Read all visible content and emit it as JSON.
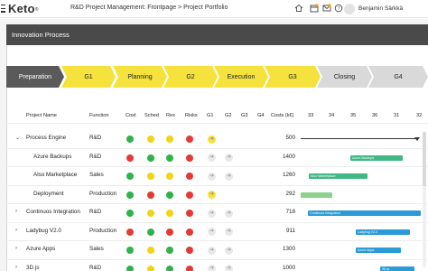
{
  "app": {
    "brand": "Keto",
    "brand_mark": "®",
    "breadcrumb": "R&D Project Management: Frontpage > Project Portfolio",
    "user_name": "Benjamin Särkkä",
    "icons": [
      "home-icon",
      "calendar-icon",
      "message-icon",
      "help-icon"
    ]
  },
  "panel": {
    "title": "Innovation Process"
  },
  "process": [
    {
      "label": "Preparation",
      "state": "active"
    },
    {
      "label": "G1",
      "state": "yellow"
    },
    {
      "label": "Planning",
      "state": "yellow"
    },
    {
      "label": "G2",
      "state": "yellow"
    },
    {
      "label": "Execution",
      "state": "yellow"
    },
    {
      "label": "G3",
      "state": "yellow"
    },
    {
      "label": "Closing",
      "state": "grey"
    },
    {
      "label": "G4",
      "state": "grey"
    }
  ],
  "colors": {
    "active": "#5a5a5a",
    "yellow": "#f5e23c",
    "grey": "#d9d9d9",
    "green": "#2db34a",
    "yellow_dot": "#f0d516",
    "red": "#e53935",
    "gantt_blue": "#2a9bd6",
    "gantt_green": "#41b883",
    "gantt_lightgreen": "#8ed08e"
  },
  "table": {
    "headers": {
      "project_name": "Project Name",
      "function": "Function",
      "cost": "Cost",
      "sched": "Sched",
      "res": "Res",
      "risks": "Risks",
      "g1": "G1",
      "g2": "G2",
      "g3": "G3",
      "g4": "G4",
      "costs": "Costs (k€)"
    },
    "weeks": [
      "33",
      "34",
      "35",
      "36",
      "31",
      "32"
    ],
    "rows": [
      {
        "toggle": "⌄",
        "name": "Process Engine",
        "function": "R&D",
        "cost": "green",
        "sched": "yellow",
        "res": "yellow",
        "risks": "red",
        "g1": "yellow",
        "g2": "",
        "g3": "",
        "g4": "",
        "costs": "500",
        "bar": null
      },
      {
        "toggle": "",
        "name": "Azure Backups",
        "function": "R&D",
        "cost": "red",
        "sched": "green",
        "res": "green",
        "risks": "red",
        "g1": "grey",
        "g2": "grey",
        "g3": "",
        "g4": "",
        "costs": "1400",
        "bar": {
          "label": "Azure Backups",
          "color": "gantt_green"
        }
      },
      {
        "toggle": "",
        "name": "Also Marketplace",
        "function": "Sales",
        "cost": "green",
        "sched": "yellow",
        "res": "yellow",
        "risks": "red",
        "g1": "grey",
        "g2": "grey",
        "g3": "",
        "g4": "",
        "costs": "1260",
        "bar": {
          "label": "Also Marketplace",
          "color": "gantt_green"
        }
      },
      {
        "toggle": "",
        "name": "Deployment",
        "function": "Production",
        "cost": "green",
        "sched": "red",
        "res": "green",
        "risks": "red",
        "g1": "yellow",
        "g2": "",
        "g3": "",
        "g4": "",
        "costs": "292",
        "bar": {
          "label": "",
          "color": "gantt_lightgreen"
        }
      },
      {
        "toggle": "›",
        "name": "Continuos Integration",
        "function": "R&D",
        "cost": "green",
        "sched": "yellow",
        "res": "yellow",
        "risks": "red",
        "g1": "grey",
        "g2": "grey",
        "g3": "",
        "g4": "",
        "costs": "718",
        "bar": {
          "label": "Continuos Integration",
          "color": "gantt_blue"
        }
      },
      {
        "toggle": "›",
        "name": "Ladybug V2.0",
        "function": "Production",
        "cost": "red",
        "sched": "green",
        "res": "red",
        "risks": "red",
        "g1": "grey",
        "g2": "grey",
        "g3": "",
        "g4": "",
        "costs": "911",
        "bar": {
          "label": "Ladybug V2.0",
          "color": "gantt_blue"
        }
      },
      {
        "toggle": "›",
        "name": "Azure Apps",
        "function": "Sales",
        "cost": "green",
        "sched": "yellow",
        "res": "green",
        "risks": "red",
        "g1": "grey",
        "g2": "grey",
        "g3": "",
        "g4": "",
        "costs": "1300",
        "bar": {
          "label": "Azure Apps",
          "color": "gantt_blue"
        }
      },
      {
        "toggle": "›",
        "name": "3D.js",
        "function": "R&D",
        "cost": "green",
        "sched": "yellow",
        "res": "green",
        "risks": "red",
        "g1": "grey",
        "g2": "grey",
        "g3": "",
        "g4": "",
        "costs": "1000",
        "bar": {
          "label": "3D.js",
          "color": "gantt_blue"
        }
      }
    ]
  }
}
